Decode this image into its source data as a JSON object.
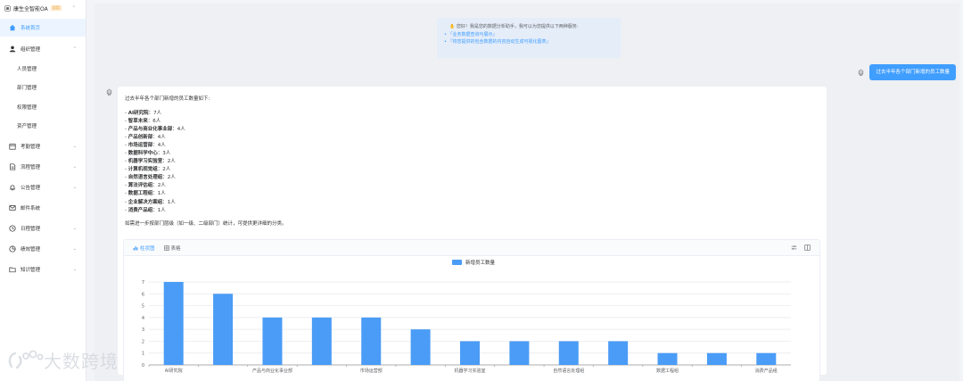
{
  "app": {
    "title": "康生全智能OA",
    "badge": "试用"
  },
  "sidebar": {
    "items": [
      {
        "label": "系统首页",
        "icon": "home-icon",
        "active": true
      },
      {
        "label": "组织管理",
        "icon": "user-icon",
        "expanded": true,
        "children": [
          "人员管理",
          "部门管理",
          "权限管理",
          "资产管理"
        ]
      },
      {
        "label": "考勤管理",
        "icon": "calendar-icon"
      },
      {
        "label": "流程管理",
        "icon": "document-icon"
      },
      {
        "label": "公告管理",
        "icon": "bell-icon"
      },
      {
        "label": "邮件系统",
        "icon": "mail-icon"
      },
      {
        "label": "日程管理",
        "icon": "clock-icon"
      },
      {
        "label": "绩效管理",
        "icon": "pie-icon"
      },
      {
        "label": "知识管理",
        "icon": "folder-icon"
      }
    ]
  },
  "welcome": {
    "greeting": "您好！我是您的数据分析助手，我可以为您提供以下两种服务:",
    "options": [
      "「业务数据查询与展示」",
      "「将您提供的包含数据的内容自动生成可视化图表」"
    ]
  },
  "user_message": "过去半年各个部门新增的员工数量",
  "reply": {
    "intro": "过去半年各个部门新增的员工数量如下:",
    "items": [
      {
        "name": "AI研究院",
        "value": "7人"
      },
      {
        "name": "智草未来",
        "value": "6人"
      },
      {
        "name": "产品与商业化事业部",
        "value": "4人"
      },
      {
        "name": "产品创新部",
        "value": "4人"
      },
      {
        "name": "市场运营部",
        "value": "4人"
      },
      {
        "name": "数据科学中心",
        "value": "3人"
      },
      {
        "name": "机器学习实验室",
        "value": "2人"
      },
      {
        "name": "计算机视觉组",
        "value": "2人"
      },
      {
        "name": "自然语言处理组",
        "value": "2人"
      },
      {
        "name": "算法评估组",
        "value": "2人"
      },
      {
        "name": "数据工程组",
        "value": "1人"
      },
      {
        "name": "企业解决方案组",
        "value": "1人"
      },
      {
        "name": "消费产品组",
        "value": "1人"
      }
    ],
    "outro": "如需进一步按部门层级（如一级、二级部门）统计，可提供更详细的分类。"
  },
  "chart_tabs": {
    "bar": "柱状图",
    "table": "表格"
  },
  "chart_data": {
    "type": "bar",
    "categories": [
      "AI研究院",
      "智草未来",
      "产品与商业化事业部",
      "产品创新部",
      "市场运营部",
      "数据科学中心",
      "机器学习实验室",
      "计算机视觉组",
      "自然语言处理组",
      "算法评估组",
      "数据工程组",
      "企业解决方案组",
      "消费产品组"
    ],
    "x_tick_labels": [
      "AI研究院",
      "",
      "产品与商业化事业部",
      "",
      "市场运营部",
      "",
      "机器学习实验室",
      "",
      "自然语言处理组",
      "",
      "数据工程组",
      "",
      "消费产品组"
    ],
    "series": [
      {
        "name": "新增员工数量",
        "values": [
          7,
          6,
          4,
          4,
          4,
          3,
          2,
          2,
          2,
          2,
          1,
          1,
          1
        ]
      }
    ],
    "ylim": [
      0,
      7
    ],
    "yticks": [
      0,
      1,
      2,
      3,
      4,
      5,
      6,
      7
    ],
    "legend": "top-center",
    "grid": true,
    "color": "#4a9cf6"
  },
  "watermark": "大数跨境",
  "colors": {
    "accent": "#409eff",
    "bar": "#4a9cf6"
  }
}
